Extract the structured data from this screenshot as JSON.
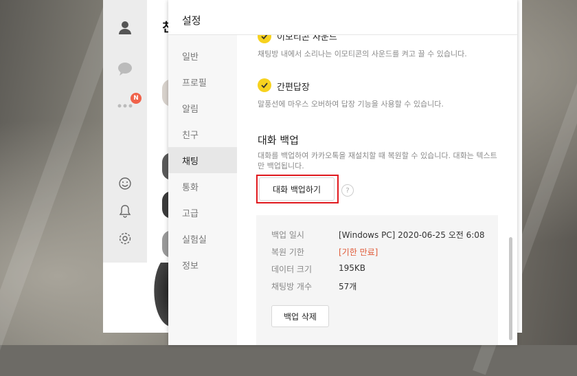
{
  "main_window": {
    "list_title": "친"
  },
  "badge": {
    "count": "N"
  },
  "settings": {
    "title": "설정",
    "nav": [
      {
        "label": "일반"
      },
      {
        "label": "프로필"
      },
      {
        "label": "알림"
      },
      {
        "label": "친구"
      },
      {
        "label": "채팅"
      },
      {
        "label": "통화"
      },
      {
        "label": "고급"
      },
      {
        "label": "실험실"
      },
      {
        "label": "정보"
      }
    ],
    "active_nav": "채팅",
    "options": [
      {
        "label": "이모티콘 사운드",
        "desc": "채팅방 내에서 소리나는 이모티콘의 사운드를 켜고 끌 수 있습니다.",
        "checked": true
      },
      {
        "label": "간편답장",
        "desc": "말풍선에 마우스 오버하여 답장 기능을 사용할 수 있습니다.",
        "checked": true
      }
    ],
    "backup": {
      "title": "대화 백업",
      "desc": "대화를 백업하여 카카오톡을 재설치할 때 복원할 수 있습니다. 대화는 텍스트만 백업됩니다.",
      "button": "대화 백업하기",
      "help": "?",
      "rows": [
        {
          "key": "백업 일시",
          "value": "[Windows PC] 2020-06-25 오전 6:08"
        },
        {
          "key": "복원 기한",
          "value": "[기한 만료]"
        },
        {
          "key": "데이터 크기",
          "value": "195KB"
        },
        {
          "key": "채팅방 개수",
          "value": "57개"
        }
      ],
      "delete_button": "백업 삭제"
    }
  },
  "colors": {
    "check": "#f7d21f",
    "highlight": "#e0191e",
    "expired": "#e05a38",
    "badge": "#f0624a"
  }
}
